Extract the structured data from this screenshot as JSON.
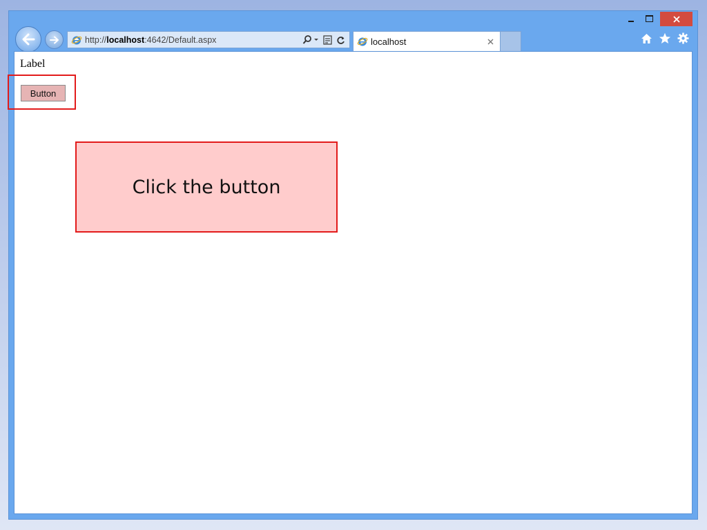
{
  "browser": {
    "address": {
      "url_prefix": "http://",
      "url_host": "localhost",
      "url_rest": ":4642/Default.aspx"
    },
    "tab": {
      "title": "localhost"
    },
    "icons": {
      "back": "back-arrow-icon",
      "forward": "forward-arrow-icon",
      "site": "ie-logo-icon",
      "search": "search-icon",
      "compat": "compatibility-view-icon",
      "refresh": "refresh-icon",
      "home": "home-icon",
      "favorites": "star-icon",
      "settings": "gear-icon",
      "minimize": "minimize-icon",
      "maximize": "maximize-icon",
      "close": "close-icon"
    }
  },
  "page": {
    "label_text": "Label",
    "button_label": "Button"
  },
  "annotation": {
    "callout_text": "Click the button",
    "highlight_color": "#e21a1a",
    "callout_fill": "#ffcccc"
  }
}
